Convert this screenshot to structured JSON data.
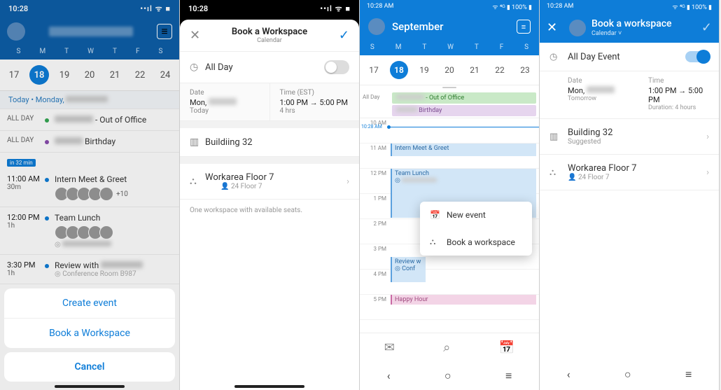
{
  "screen1": {
    "status_time": "10:28",
    "weekdays": [
      "S",
      "M",
      "T",
      "W",
      "T",
      "F",
      "S"
    ],
    "dates": [
      "17",
      "18",
      "19",
      "20",
      "21",
      "22",
      "24"
    ],
    "selected_index": 1,
    "today_label": "Today • Monday,",
    "agenda": {
      "ooo": {
        "allday": "ALL DAY",
        "title": " - Out of Office",
        "dot": "#35a853"
      },
      "bday": {
        "allday": "ALL DAY",
        "title": " Birthday",
        "dot": "#8a4caf"
      },
      "badge": "in 32 min",
      "meet": {
        "time": "11:00 AM",
        "dur": "30m",
        "title": "Intern Meet & Greet",
        "more": "+10",
        "dot": "#0e7dd8"
      },
      "lunch": {
        "time": "12:00 PM",
        "dur": "1h",
        "title": "Team Lunch",
        "dot": "#0e7dd8"
      },
      "review": {
        "time": "3:30 PM",
        "dur": "1h",
        "title": "Review with",
        "loc": "Conference Room B987",
        "dot": "#0e7dd8"
      }
    },
    "sheet": {
      "create": "Create event",
      "book": "Book a Workspace",
      "cancel": "Cancel"
    }
  },
  "screen2": {
    "status_time": "10:28",
    "title": "Book a Workspace",
    "subtitle": "Calendar",
    "allday_label": "All Day",
    "date_lbl": "Date",
    "date_val": "Mon,",
    "date_sub": "Today",
    "time_lbl": "Time (EST)",
    "time_val": "1:00 PM → 5:00 PM",
    "time_sub": "4 hrs",
    "building": "Buildiing 32",
    "workarea": "Workarea Floor 7",
    "workarea_sub": "24   Floor 7",
    "hint": "One workspace with available seats."
  },
  "screen3": {
    "status_time": "10:28 AM",
    "status_right": "100%",
    "month": "September",
    "weekdays": [
      "S",
      "M",
      "T",
      "W",
      "T",
      "F",
      "S"
    ],
    "dates": [
      "17",
      "18",
      "19",
      "20",
      "21",
      "22",
      "23"
    ],
    "selected_index": 1,
    "allday_lbl": "All Day",
    "ev_ooo": " - Out of Office",
    "ev_bday": " Birthday",
    "nowlbl": "10:28 AM",
    "hours": [
      "10 AM",
      "11 AM",
      "12 PM",
      "1 PM",
      "2 PM",
      "3 PM",
      "4 PM",
      "5 PM"
    ],
    "ev_intern": "Intern Meet & Greet",
    "ev_lunch": "Team Lunch",
    "ev_review": "Review w",
    "ev_happy": "Happy Hour",
    "popup": {
      "newevent": "New event",
      "book": "Book a workspace"
    }
  },
  "screen4": {
    "status_time": "10:28 AM",
    "status_right": "100%",
    "title": "Book a workspace",
    "subtitle": "Calendar ˅",
    "allday": "All Day Event",
    "date_lbl": "Date",
    "date_val": "Mon,",
    "date_sub": "Tomorrow",
    "time_lbl": "Time",
    "time_val": "1:00 PM → 5:00 PM",
    "time_sub": "Duration: 4 hours",
    "building": "Building 32",
    "building_sub": "Suggested",
    "workarea": "Workarea Floor 7",
    "workarea_sub": "24   Floor 7"
  }
}
